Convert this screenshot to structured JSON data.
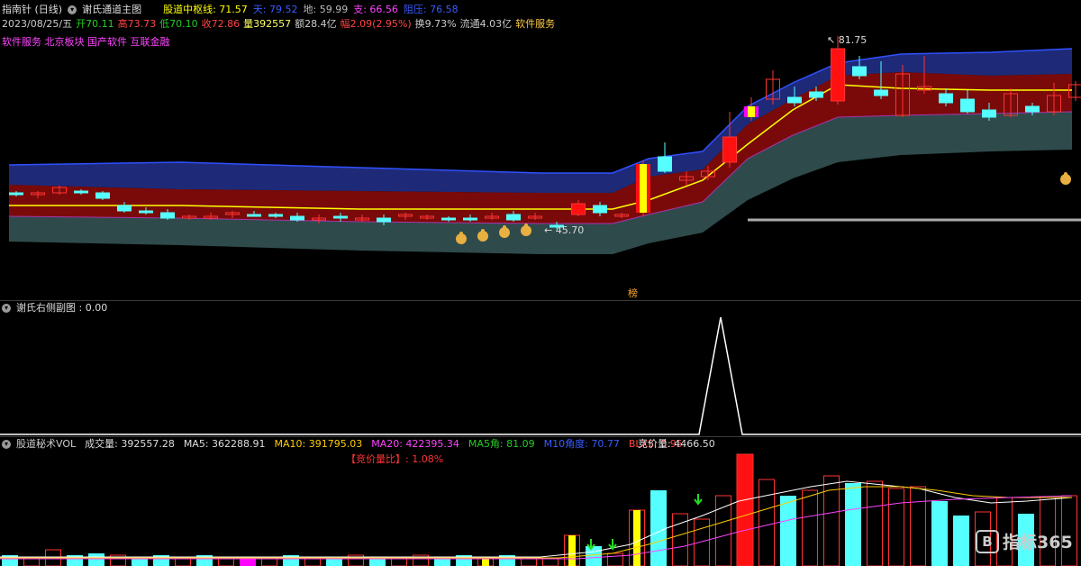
{
  "main_panel": {
    "symbol": "指南针 (日线)",
    "indicator_name": "谢氏通道主图",
    "indicators": [
      {
        "label": "股道中枢线: 71.57",
        "color": "#ffff00"
      },
      {
        "label": "天: 79.52",
        "color": "#3a5bff"
      },
      {
        "label": "地: 59.99",
        "color": "#bbbbbb"
      },
      {
        "label": "支: 66.56",
        "color": "#ff44ff"
      },
      {
        "label": "阻压: 76.58",
        "color": "#3a5bff"
      }
    ],
    "quote": [
      {
        "label": "2023/08/25/五",
        "color": "#cccccc"
      },
      {
        "label": "开70.11",
        "color": "#22cc22"
      },
      {
        "label": "高73.73",
        "color": "#ff4444"
      },
      {
        "label": "低70.10",
        "color": "#22cc22"
      },
      {
        "label": "收72.86",
        "color": "#ff4444"
      },
      {
        "label": "量392557",
        "color": "#ffff66"
      },
      {
        "label": "额28.4亿",
        "color": "#cccccc"
      },
      {
        "label": "幅2.09(2.95%)",
        "color": "#ff4444"
      },
      {
        "label": "换9.73%",
        "color": "#cccccc"
      },
      {
        "label": "流通4.03亿",
        "color": "#cccccc"
      },
      {
        "label": "软件服务",
        "color": "#ffcc44"
      }
    ],
    "concepts": "软件服务 北京板块 国产软件 互联金融",
    "high_marker": "81.75",
    "low_marker": "45.70",
    "bottom_tag": "榜"
  },
  "sub_panel": {
    "title": "谢氏右侧副图 : 0.00"
  },
  "volume_panel": {
    "indicators": [
      {
        "label": "股道秘术VOL",
        "color": "#cccccc"
      },
      {
        "label": "成交量: 392557.28",
        "color": "#dddddd"
      },
      {
        "label": "MA5: 362288.91",
        "color": "#dddddd"
      },
      {
        "label": "MA10: 391795.03",
        "color": "#ffcc00"
      },
      {
        "label": "MA20: 422395.34",
        "color": "#ff44ff"
      },
      {
        "label": "MA5角: 81.09",
        "color": "#22cc22"
      },
      {
        "label": "M10角度: 70.77",
        "color": "#3a5bff"
      },
      {
        "label": "BLXS: 0.95",
        "color": "#ff4444"
      }
    ],
    "bid_volume": "竞价量: 4466.50",
    "bid_ratio": "【竞价量比】: 1.08%"
  },
  "watermark": "指标365",
  "colors": {
    "up": "#ff3333",
    "down": "#55ffff",
    "yellow": "#ffff00",
    "band_red": "#8b0000",
    "band_teal": "#2e4a4a"
  }
}
